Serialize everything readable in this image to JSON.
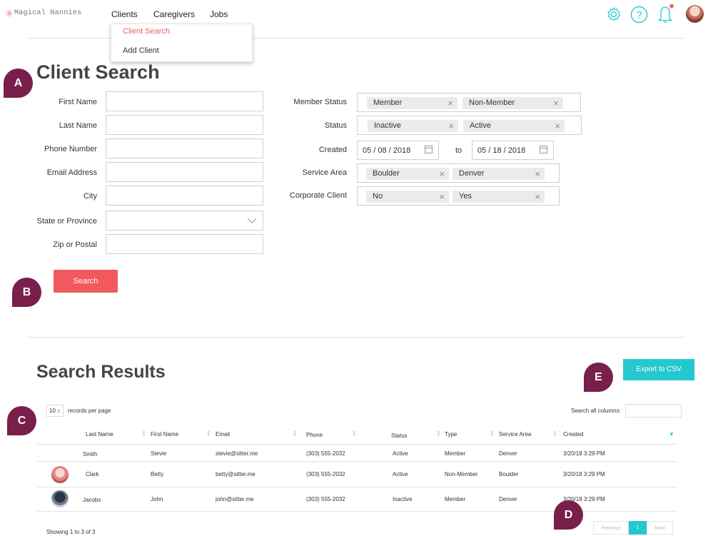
{
  "app": {
    "logo_text": "Magical Nannies",
    "nav": [
      "Clients",
      "Caregivers",
      "Jobs"
    ],
    "dropdown": [
      "Client Search",
      "Add Client"
    ],
    "icons": [
      "gear-icon",
      "help-icon",
      "bell-icon",
      "avatar"
    ],
    "accent_color": "#f1595f",
    "teal_color": "#25c8ce"
  },
  "search": {
    "title": "Client Search",
    "left_labels": [
      "First Name",
      "Last Name",
      "Phone Number",
      "Email Address",
      "City",
      "State or Province",
      "Zip or Postal"
    ],
    "member_status": {
      "label": "Member Status",
      "chips": [
        "Member",
        "Non-Member"
      ]
    },
    "status": {
      "label": "Status",
      "chips": [
        "Inactive",
        "Active"
      ]
    },
    "created": {
      "label": "Created",
      "from": "05 / 08 / 2018",
      "to_label": "to",
      "to": "05 / 18 / 2018"
    },
    "service_area": {
      "label": "Service Area",
      "chips": [
        "Boulder",
        "Denver"
      ]
    },
    "corporate": {
      "label": "Corporate Client",
      "chips": [
        "No",
        "Yes"
      ]
    },
    "button": "Search"
  },
  "results": {
    "title": "Search Results",
    "export_button": "Export to CSV",
    "per_page_value": "10 ↕",
    "per_page_label": "records per page",
    "search_label": "Search all columns:",
    "columns": [
      "Last Name",
      "First Name",
      "Email",
      "Phone",
      "Status",
      "Type",
      "Service Area",
      "Created"
    ],
    "rows": [
      [
        "Smith",
        "Stevie",
        "stevie@sitter.me",
        "(303) 555-2032",
        "Active",
        "Member",
        "Denver",
        "3/20/18 3:29 PM"
      ],
      [
        "Clark",
        "Betty",
        "betty@sitter.me",
        "(303) 555-2032",
        "Active",
        "Non-Member",
        "Boulder",
        "3/20/18 3:29 PM"
      ],
      [
        "Jacobs",
        "John",
        "john@sitter.me",
        "(303) 555-2032",
        "Inactive",
        "Member",
        "Denver",
        "3/20/18 3:29 PM"
      ]
    ],
    "showing": "Showing 1 to 3 of 3",
    "pagination": [
      "Previous",
      "1",
      "Next"
    ]
  },
  "badges": [
    "A",
    "B",
    "C",
    "D",
    "E"
  ]
}
